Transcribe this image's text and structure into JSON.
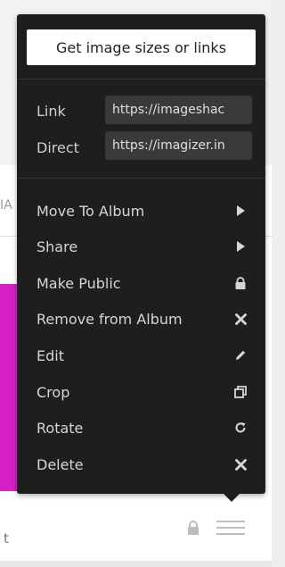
{
  "popup": {
    "get_sizes_button": "Get image sizes or links",
    "links": [
      {
        "label": "Link",
        "value": "https://imageshac"
      },
      {
        "label": "Direct",
        "value": "https://imagizer.in"
      }
    ],
    "menu_items": [
      {
        "label": "Move To Album",
        "icon": "caret-right-icon"
      },
      {
        "label": "Share",
        "icon": "caret-right-icon"
      },
      {
        "label": "Make Public",
        "icon": "lock-icon"
      },
      {
        "label": "Remove from Album",
        "icon": "close-icon"
      },
      {
        "label": "Edit",
        "icon": "pencil-icon"
      },
      {
        "label": "Crop",
        "icon": "crop-icon"
      },
      {
        "label": "Rotate",
        "icon": "rotate-icon"
      },
      {
        "label": "Delete",
        "icon": "close-icon"
      }
    ]
  },
  "background": {
    "fragment_text": "IA",
    "caption_text": "t",
    "image_color": "#d61fc6"
  },
  "colors": {
    "menu_background": "#1e1e1e",
    "field_background": "#3a3a3a",
    "menu_text": "#d6d6d6",
    "button_background": "#ffffff"
  }
}
